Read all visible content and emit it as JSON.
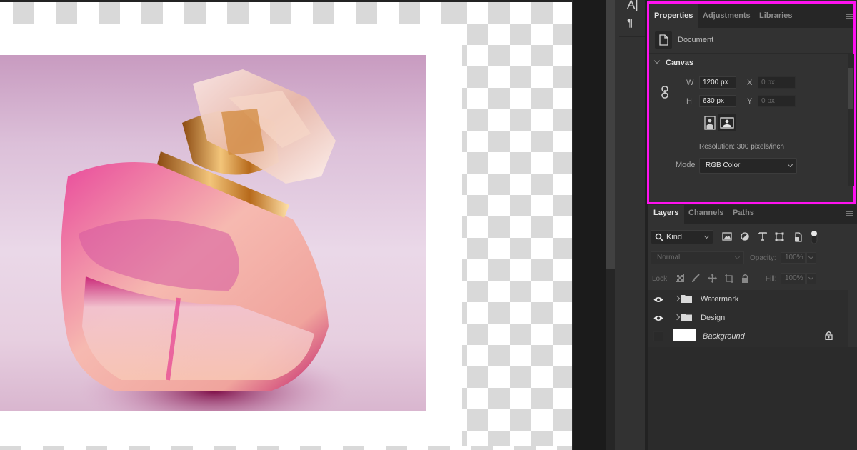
{
  "app": {
    "accent_highlight_color": "#ff12f0"
  },
  "toolbar_right": {
    "icons": [
      "character-icon",
      "paragraph-icon"
    ],
    "character_glyph": "A|",
    "paragraph_glyph": "¶"
  },
  "canvas": {
    "image_subject": "pink perfume bottle with gold cap"
  },
  "properties": {
    "tabs": [
      {
        "label": "Properties",
        "active": true
      },
      {
        "label": "Adjustments",
        "active": false
      },
      {
        "label": "Libraries",
        "active": false
      }
    ],
    "document_label": "Document",
    "section_title": "Canvas",
    "width_label": "W",
    "width_value": "1200 px",
    "height_label": "H",
    "height_value": "630 px",
    "x_label": "X",
    "x_value": "0 px",
    "y_label": "Y",
    "y_value": "0 px",
    "orientation_selected": "landscape",
    "resolution_text": "Resolution: 300 pixels/inch",
    "mode_label": "Mode",
    "mode_value": "RGB Color"
  },
  "layers": {
    "tabs": [
      {
        "label": "Layers",
        "active": true
      },
      {
        "label": "Channels",
        "active": false
      },
      {
        "label": "Paths",
        "active": false
      }
    ],
    "filter_kind": "Kind",
    "blend_mode": "Normal",
    "opacity_label": "Opacity:",
    "opacity_value": "100%",
    "lock_label": "Lock:",
    "fill_label": "Fill:",
    "fill_value": "100%",
    "items": [
      {
        "name": "Watermark",
        "type": "group",
        "visible": true
      },
      {
        "name": "Design",
        "type": "group",
        "visible": true
      },
      {
        "name": "Background",
        "type": "background",
        "visible": false,
        "locked": true
      }
    ]
  }
}
